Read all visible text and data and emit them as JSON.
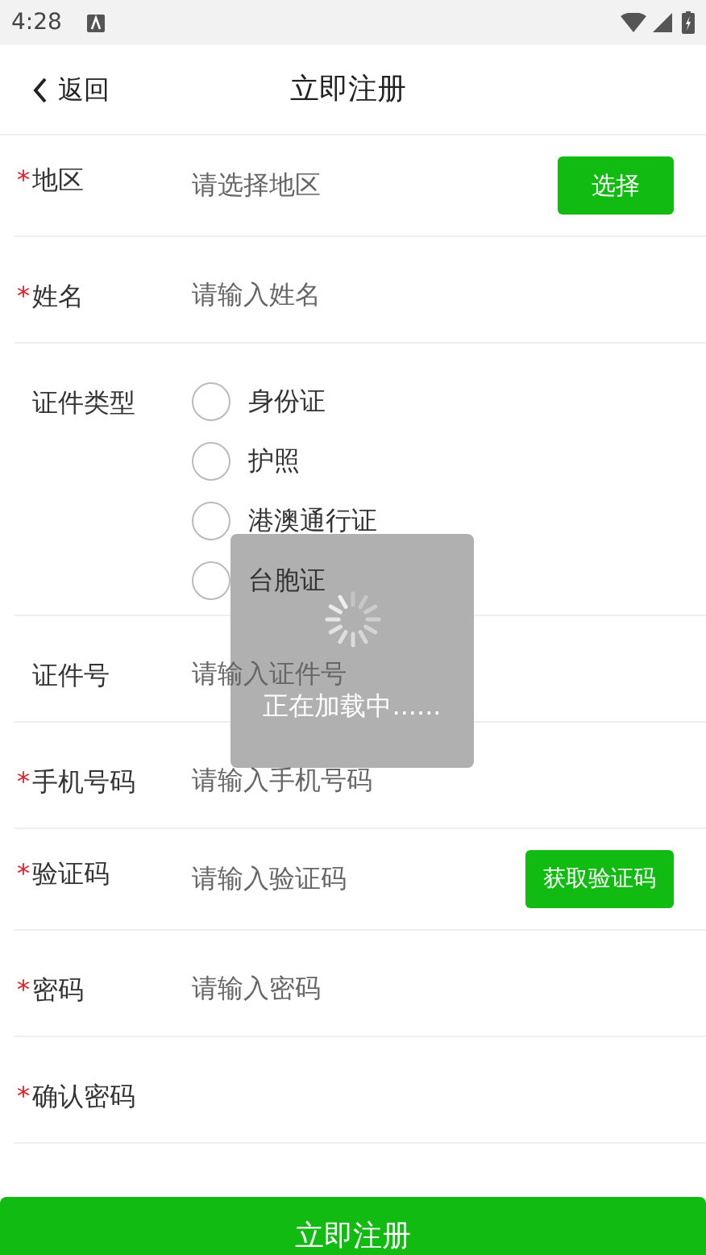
{
  "status_bar": {
    "time": "4:28"
  },
  "header": {
    "back": "返回",
    "title": "立即注册"
  },
  "fields": [
    {
      "kind": "select",
      "label": "地区",
      "mark": "*",
      "placeholder": "请选择地区",
      "button": "选择"
    },
    {
      "kind": "input",
      "label": "姓名",
      "mark": "*",
      "placeholder": "请输入姓名"
    },
    {
      "kind": "radio",
      "label": "证件类型",
      "options": [
        {
          "label": "身份证",
          "selected": false
        },
        {
          "label": "护照",
          "selected": false
        },
        {
          "label": "港澳通行证",
          "selected": false
        },
        {
          "label": "台胞证",
          "selected": false
        }
      ]
    },
    {
      "kind": "input",
      "label": "证件号",
      "placeholder": "请输入证件号"
    },
    {
      "kind": "input",
      "label": "手机号码",
      "mark": "*",
      "placeholder": "请输入手机号码"
    },
    {
      "kind": "code",
      "label": "验证码",
      "mark": "*",
      "placeholder": "请输入验证码",
      "button": "获取验证码"
    },
    {
      "kind": "input",
      "label": "密码",
      "mark": "*",
      "placeholder": "请输入密码"
    },
    {
      "kind": "input",
      "label": "确认密码",
      "mark": "*"
    }
  ],
  "submit": "立即注册",
  "loading": {
    "text": "正在加载中......"
  }
}
